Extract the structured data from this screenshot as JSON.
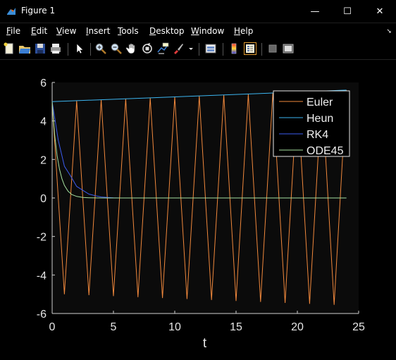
{
  "window": {
    "title": "Figure 1",
    "minimize_glyph": "—",
    "maximize_glyph": "☐",
    "close_glyph": "✕"
  },
  "menu": [
    {
      "label": "File",
      "ul": "F",
      "rest": "ile"
    },
    {
      "label": "Edit",
      "ul": "E",
      "rest": "dit"
    },
    {
      "label": "View",
      "ul": "V",
      "rest": "iew"
    },
    {
      "label": "Insert",
      "ul": "I",
      "rest": "nsert"
    },
    {
      "label": "Tools",
      "ul": "T",
      "rest": "ools"
    },
    {
      "label": "Desktop",
      "ul": "D",
      "rest": "esktop"
    },
    {
      "label": "Window",
      "ul": "W",
      "rest": "indow"
    },
    {
      "label": "Help",
      "ul": "H",
      "rest": "elp"
    }
  ],
  "toolbar": [
    "new-figure-icon",
    "open-file-icon",
    "save-icon",
    "print-icon",
    "edit-plot-arrow-icon",
    "zoom-in-icon",
    "zoom-out-icon",
    "pan-hand-icon",
    "rotate-3d-icon",
    "data-cursor-icon",
    "brush-icon",
    "brush-dropdown-icon",
    "link-plot-icon",
    "insert-colorbar-icon",
    "insert-legend-icon",
    "hide-plot-tools-icon",
    "show-plot-tools-icon"
  ],
  "chart_data": {
    "type": "line",
    "title": "",
    "xlabel": "t",
    "ylabel": "",
    "xlim": [
      0,
      25
    ],
    "ylim": [
      -6,
      6
    ],
    "xticks": [
      "0",
      "5",
      "10",
      "15",
      "20",
      "25"
    ],
    "yticks": [
      "6",
      "4",
      "2",
      "0",
      "-2",
      "-4",
      "-6"
    ],
    "legend_position": "top-right",
    "colors": {
      "Euler": "#f0883c",
      "Heun": "#3cb5f0",
      "RK4": "#3c5cf0",
      "ODE45": "#a6e2a0"
    },
    "series": [
      {
        "name": "Euler",
        "x": [
          0,
          1,
          2,
          3,
          4,
          5,
          6,
          7,
          8,
          9,
          10,
          11,
          12,
          13,
          14,
          15,
          16,
          17,
          18,
          19,
          20,
          21,
          22,
          23,
          24
        ],
        "y": [
          5,
          -5.0,
          5.05,
          -5.05,
          5.1,
          -5.1,
          5.15,
          -5.15,
          5.2,
          -5.2,
          5.25,
          -5.25,
          5.3,
          -5.3,
          5.35,
          -5.35,
          5.4,
          -5.4,
          5.45,
          -5.45,
          5.5,
          -5.5,
          5.55,
          -5.55,
          5.6
        ]
      },
      {
        "name": "Heun",
        "x": [
          0,
          24
        ],
        "y": [
          5,
          5.6
        ]
      },
      {
        "name": "RK4",
        "x": [
          0,
          0.5,
          1,
          1.5,
          2,
          2.5,
          3,
          3.5,
          4,
          4.5,
          5,
          5.5,
          24
        ],
        "y": [
          5,
          3.0,
          1.65,
          1.15,
          0.6,
          0.4,
          0.2,
          0.12,
          0.05,
          0.03,
          0.01,
          0,
          0
        ]
      },
      {
        "name": "ODE45",
        "x": [
          0,
          0.2,
          0.4,
          0.6,
          0.8,
          1.0,
          1.3,
          1.6,
          2.0,
          2.5,
          3.0,
          4.0,
          24
        ],
        "y": [
          5,
          3.3,
          2.2,
          1.5,
          1.0,
          0.65,
          0.35,
          0.18,
          0.08,
          0.03,
          0.01,
          0,
          0
        ]
      }
    ]
  }
}
